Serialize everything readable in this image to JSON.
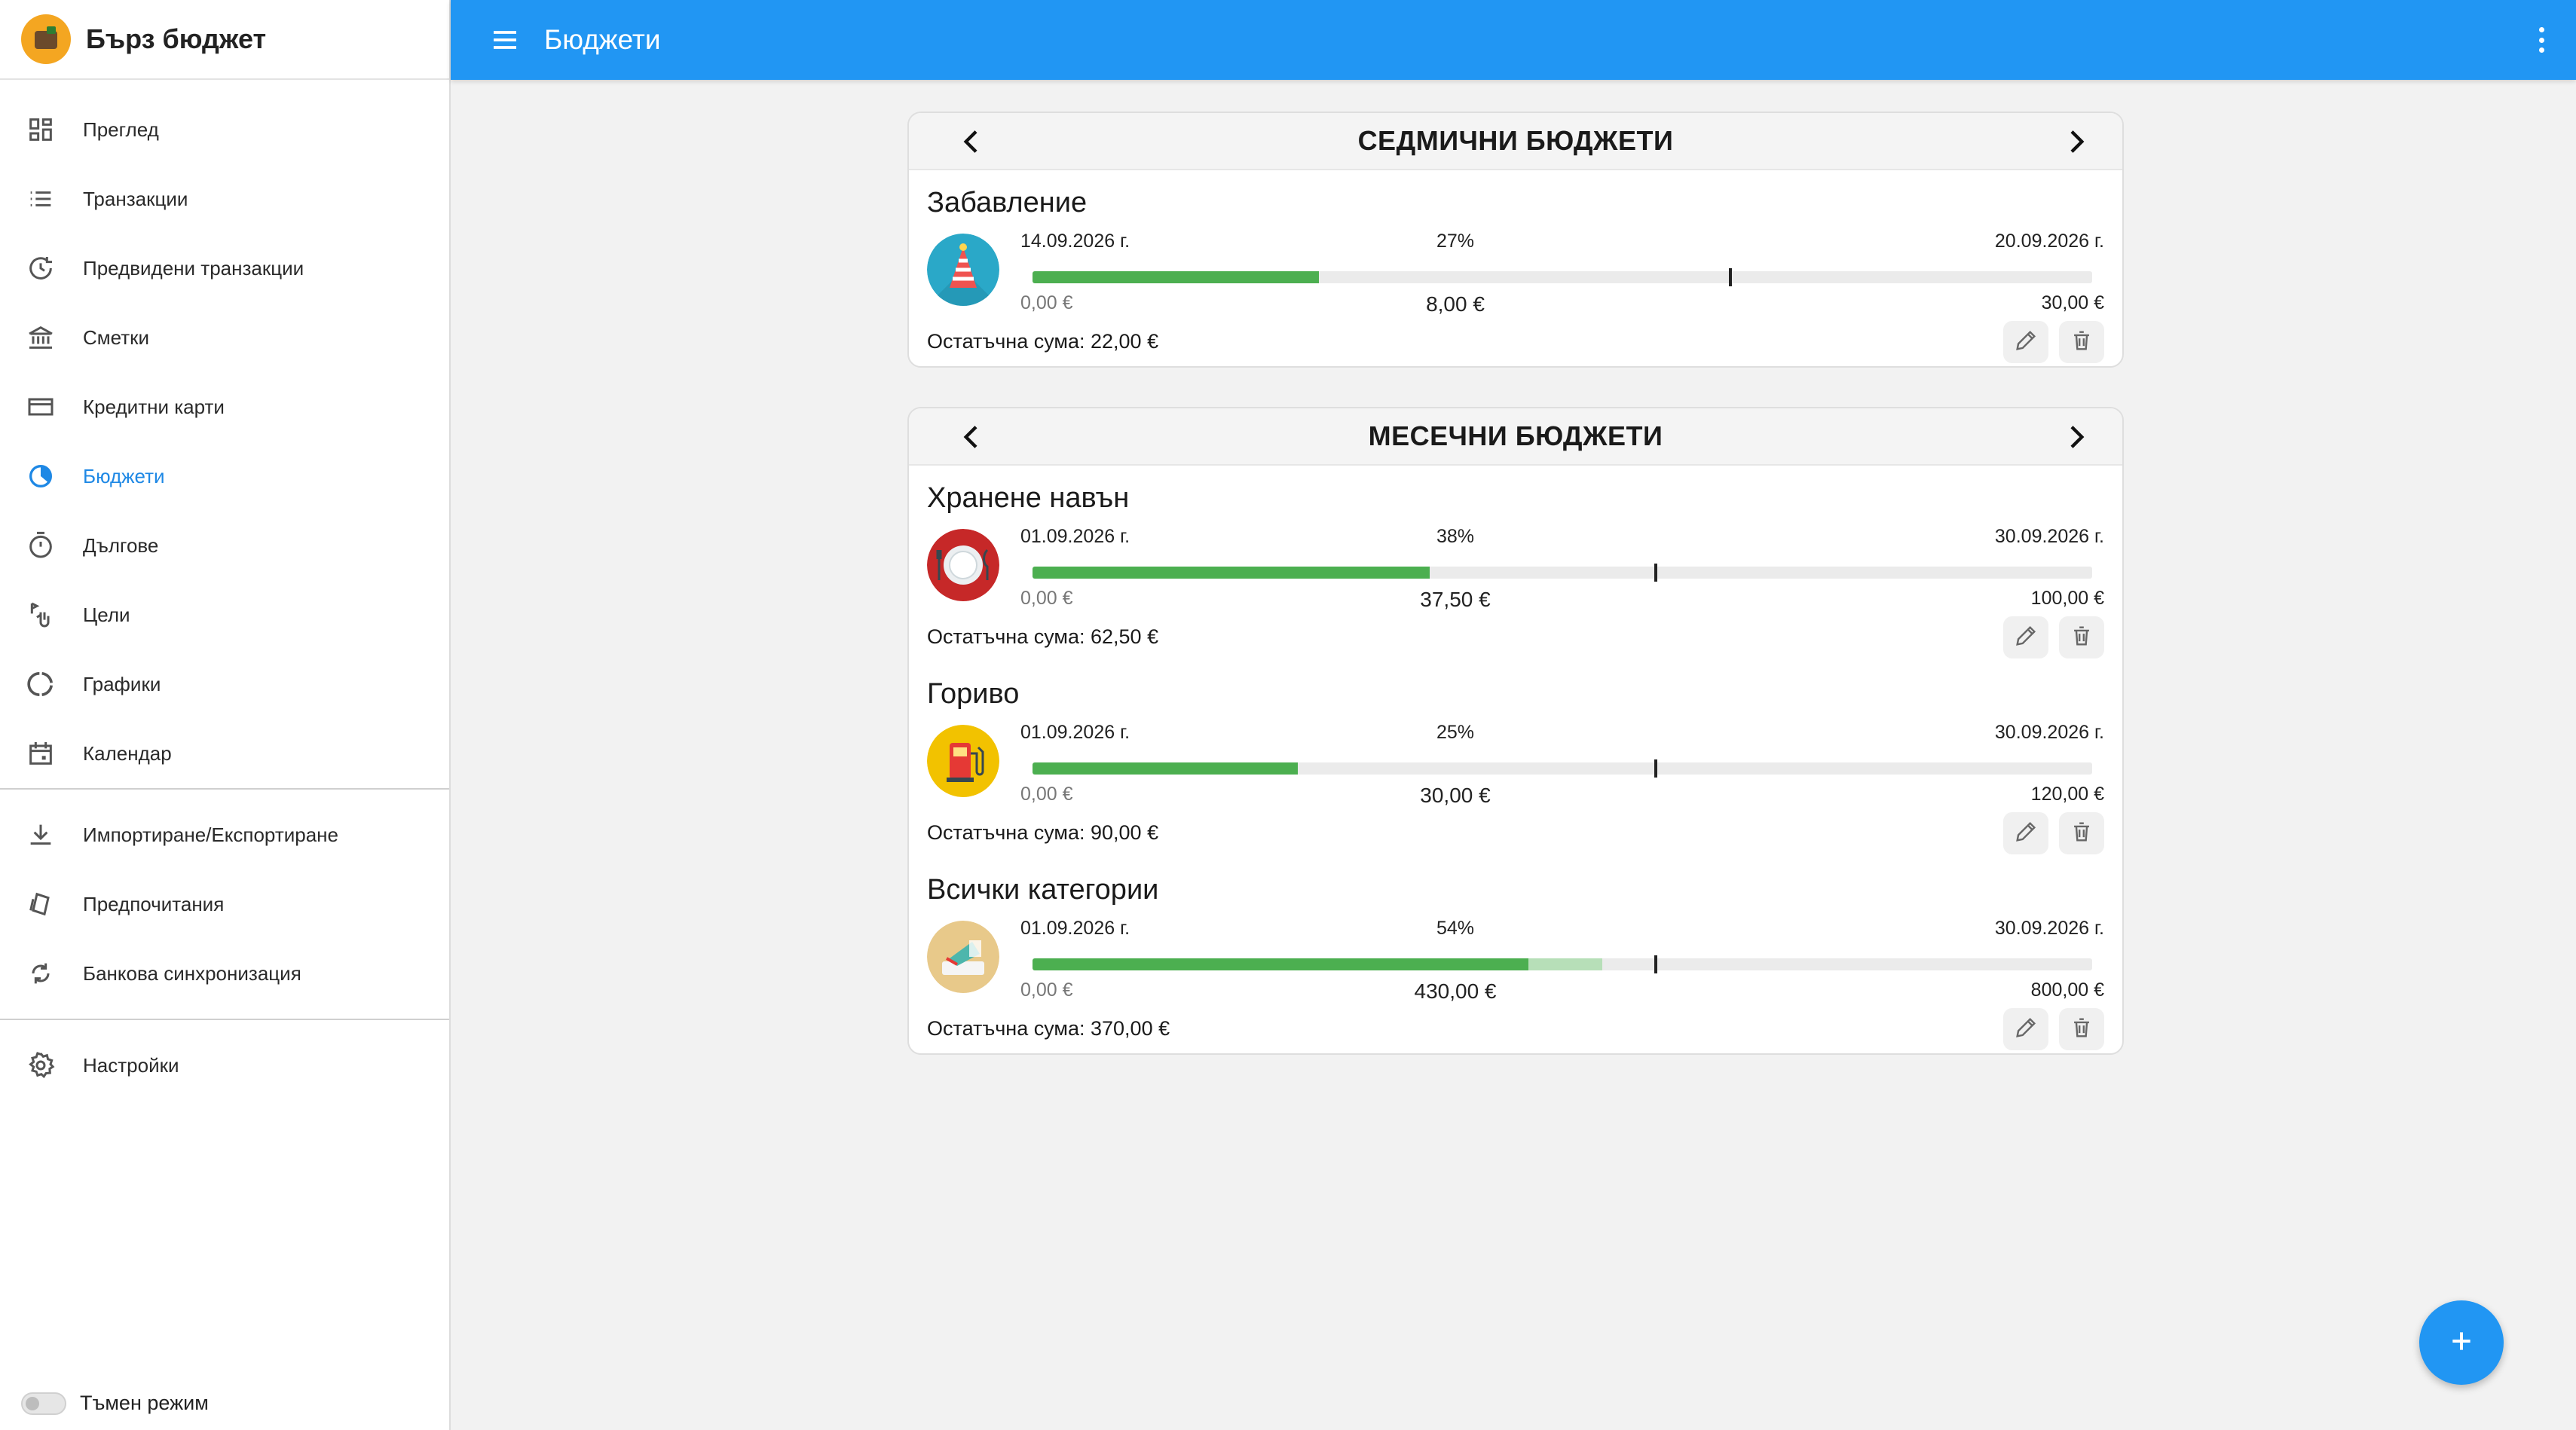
{
  "app": {
    "title": "Бърз бюджет"
  },
  "topbar": {
    "title": "Бюджети"
  },
  "sidebar": {
    "items": [
      {
        "label": "Преглед",
        "icon": "dashboard-icon"
      },
      {
        "label": "Транзакции",
        "icon": "list-icon"
      },
      {
        "label": "Предвидени транзакции",
        "icon": "scheduled-icon"
      },
      {
        "label": "Сметки",
        "icon": "bank-icon"
      },
      {
        "label": "Кредитни карти",
        "icon": "credit-card-icon"
      },
      {
        "label": "Бюджети",
        "icon": "pie-chart-icon",
        "active": true
      },
      {
        "label": "Дългове",
        "icon": "timer-icon"
      },
      {
        "label": "Цели",
        "icon": "goal-icon"
      },
      {
        "label": "Графики",
        "icon": "donut-chart-icon"
      },
      {
        "label": "Календар",
        "icon": "calendar-icon"
      },
      {
        "label": "Импортиране/Експортиране",
        "icon": "download-icon"
      },
      {
        "label": "Предпочитания",
        "icon": "preferences-icon"
      },
      {
        "label": "Банкова синхронизация",
        "icon": "sync-icon"
      },
      {
        "label": "Настройки",
        "icon": "gear-icon"
      }
    ],
    "dark_mode": {
      "label": "Тъмен режим",
      "enabled": false
    }
  },
  "weekly": {
    "title": "СЕДМИЧНИ БЮДЖЕТИ",
    "budgets": [
      {
        "name": "Забавление",
        "icon": "party-hat-icon",
        "start_date": "14.09.2026 г.",
        "end_date": "20.09.2026 г.",
        "percent": "27%",
        "progress": 0.27,
        "overflow": 0,
        "time_marker": 0.657,
        "min": "0,00 €",
        "spent": "8,00 €",
        "max": "30,00 €",
        "remaining": "Остатъчна сума: 22,00 €"
      }
    ]
  },
  "monthly": {
    "title": "МЕСЕЧНИ БЮДЖЕТИ",
    "budgets": [
      {
        "name": "Хранене навън",
        "icon": "dining-plate-icon",
        "start_date": "01.09.2026 г.",
        "end_date": "30.09.2026 г.",
        "percent": "38%",
        "progress": 0.375,
        "overflow": 0,
        "time_marker": 0.587,
        "min": "0,00 €",
        "spent": "37,50 €",
        "max": "100,00 €",
        "remaining": "Остатъчна сума: 62,50 €"
      },
      {
        "name": "Гориво",
        "icon": "fuel-pump-icon",
        "start_date": "01.09.2026 г.",
        "end_date": "30.09.2026 г.",
        "percent": "25%",
        "progress": 0.25,
        "overflow": 0,
        "time_marker": 0.587,
        "min": "0,00 €",
        "spent": "30,00 €",
        "max": "120,00 €",
        "remaining": "Остатъчна сума: 90,00 €"
      },
      {
        "name": "Всички категории",
        "icon": "all-categories-icon",
        "start_date": "01.09.2026 г.",
        "end_date": "30.09.2026 г.",
        "percent": "54%",
        "progress": 0.468,
        "overflow": 0.07,
        "time_marker": 0.587,
        "min": "0,00 €",
        "spent": "430,00 €",
        "max": "800,00 €",
        "remaining": "Остатъчна сума: 370,00 €"
      }
    ]
  },
  "colors": {
    "primary": "#2196f3",
    "progress": "#4caf50",
    "progress_light": "#b7dfb8"
  }
}
